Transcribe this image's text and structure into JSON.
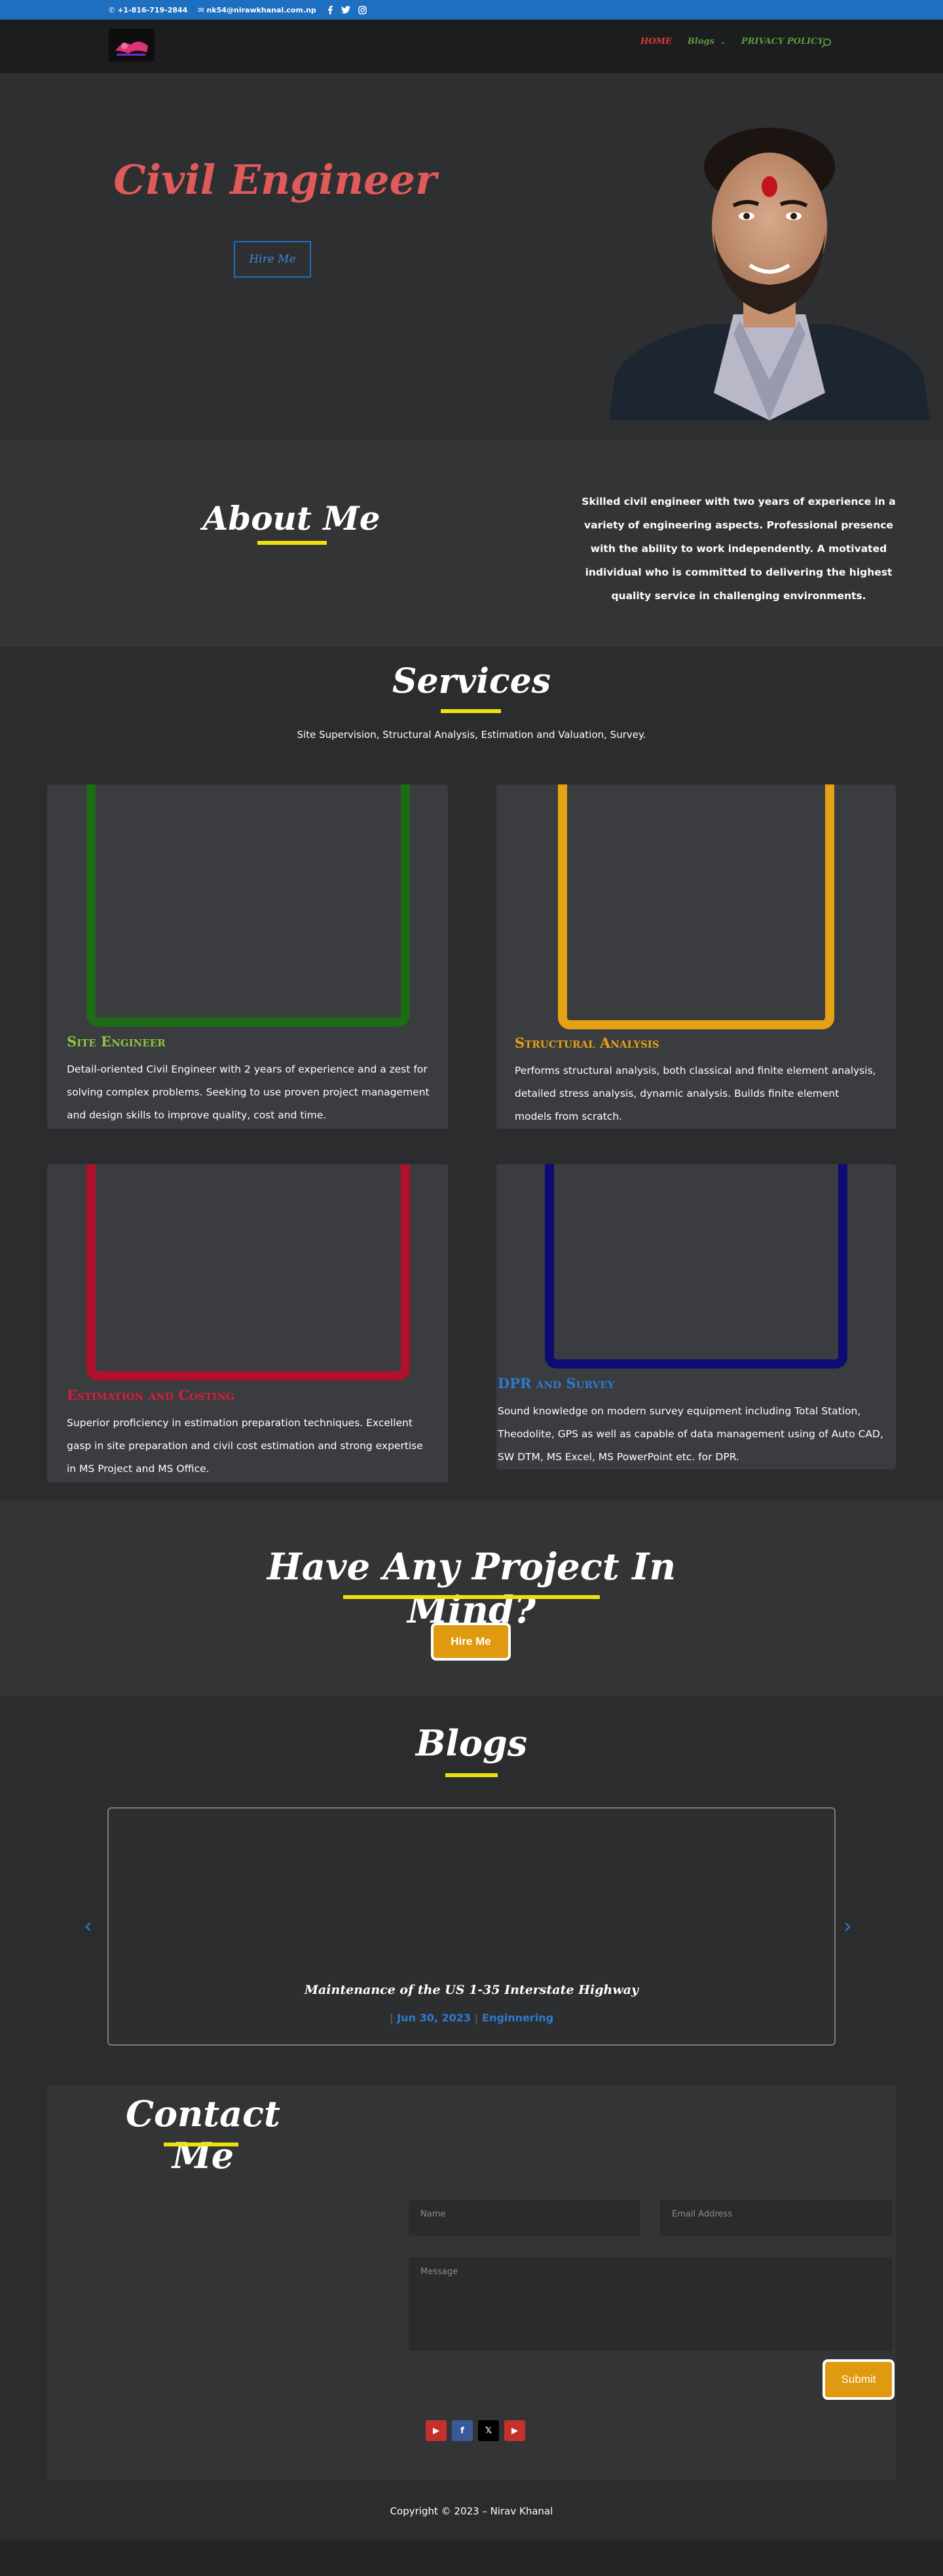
{
  "topbar": {
    "phone": "+1-816-719-2844",
    "email": "nk54@nirawkhanal.com.np",
    "social": [
      "facebook-icon",
      "twitter-icon",
      "instagram-icon"
    ]
  },
  "nav": {
    "logo_alt": "logo",
    "items": [
      {
        "label": "HOME"
      },
      {
        "label": "Blogs"
      },
      {
        "label": "PRIVACY POLICY"
      }
    ],
    "blogs_has_dropdown": true
  },
  "hero": {
    "title": "Civil Engineer",
    "button": "Hire Me"
  },
  "about": {
    "title": "About Me",
    "text": "Skilled civil engineer with two years of experience in a variety of engineering aspects. Professional presence with the ability to work independently. A motivated individual who is committed to delivering the highest quality service in challenging environments."
  },
  "services": {
    "title": "Services",
    "subtitle": "Site Supervision, Structural Analysis, Estimation and Valuation, Survey.",
    "cards": [
      {
        "title": "Site Engineer",
        "color": "#1e6b16",
        "title_color": "#8cc63f",
        "text": "Detail-oriented Civil Engineer with 2 years of experience and a zest for solving complex problems. Seeking to use proven project management and design skills to improve quality, cost and time."
      },
      {
        "title": "Structural Analysis",
        "color": "#e6a214",
        "title_color": "#e6a214",
        "text": "Performs structural analysis, both classical and finite element analysis, detailed stress analysis, dynamic analysis. Builds finite element models from scratch."
      },
      {
        "title": "Estimation and Costing",
        "color": "#b0102c",
        "title_color": "#d81e3c",
        "text": "Superior proficiency in estimation preparation techniques. Excellent gasp in site preparation and civil cost estimation and strong expertise in MS Project and MS Office."
      },
      {
        "title": "DPR and Survey",
        "color": "#0c0c74",
        "title_color": "#2c7ad0",
        "text": "Sound knowledge on modern survey equipment including Total Station, Theodolite, GPS as well as capable of data management using of Auto CAD, SW DTM, MS Excel, MS PowerPoint etc. for DPR."
      }
    ]
  },
  "project": {
    "title": "Have Any Project In Mind?",
    "button": "Hire Me"
  },
  "blogs": {
    "title": "Blogs",
    "slide_title": "Maintenance of the US 1-35 Interstate Highway",
    "slide_date": "Jun 30, 2023",
    "slide_category": "Enginnering"
  },
  "contact": {
    "title": "Contact Me",
    "name_placeholder": "Name",
    "email_placeholder": "Email Address",
    "message_placeholder": "Message",
    "submit": "Submit"
  },
  "footer": {
    "social": [
      {
        "icon": "youtube-icon",
        "color": "#c4302b"
      },
      {
        "icon": "facebook-icon",
        "color": "#3b5998"
      },
      {
        "icon": "twitter-icon",
        "color": "#000000"
      },
      {
        "icon": "youtube-icon",
        "color": "#c4302b"
      }
    ],
    "copyright": "Copyright © 2023 – Nirav Khanal"
  },
  "colors": {
    "accent_blue": "#1f6fc1",
    "underline_yellow": "#f0e010",
    "button_orange": "#e09a10",
    "hero_title": "#e05a5a"
  }
}
